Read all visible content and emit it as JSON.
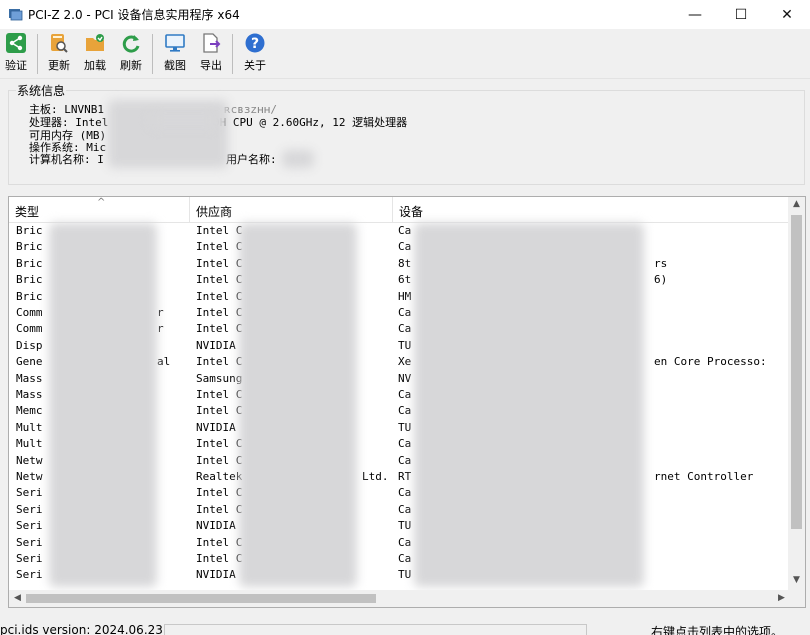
{
  "window": {
    "title": "PCI-Z 2.0 - PCI 设备信息实用程序 x64",
    "minimize": "—",
    "maximize": "☐",
    "close": "✕"
  },
  "toolbar": {
    "verify": "验证",
    "update": "更新",
    "load": "加载",
    "refresh": "刷新",
    "screenshot": "截图",
    "export": "导出",
    "about": "关于"
  },
  "system_info": {
    "group_title": "系统信息",
    "motherboard": "主板:  LNVNB1",
    "motherboard_tail": "ʀcʙɜᴢʜʜ/",
    "cpu": "处理器: Intel",
    "cpu_tail": "0H CPU @ 2.60GHz, 12 逻辑处理器",
    "memory": "可用内存 (MB)",
    "os": "操作系统: Mic",
    "computer_name": "计算机名称: I",
    "user_name": "用户名称:"
  },
  "list": {
    "headers": [
      "类型",
      "供应商",
      "设备"
    ],
    "sort_indicator": "^",
    "rows": [
      [
        "Bric",
        "Intel C",
        "Ca"
      ],
      [
        "Bric",
        "Intel C",
        "Ca"
      ],
      [
        "Bric",
        "Intel C",
        "8t",
        "rs"
      ],
      [
        "Bric",
        "Intel C",
        "6t",
        "6)"
      ],
      [
        "Bric",
        "Intel C",
        "HM"
      ],
      [
        "Comm",
        "Intel C",
        "Ca",
        "r"
      ],
      [
        "Comm",
        "Intel C",
        "Ca",
        "r"
      ],
      [
        "Disp",
        "NVIDIA",
        "TU"
      ],
      [
        "Gene",
        "Intel C",
        "Xe",
        "al",
        "en Core Processo:"
      ],
      [
        "Mass",
        "Samsung",
        "NV"
      ],
      [
        "Mass",
        "Intel C",
        "Ca"
      ],
      [
        "Memc",
        "Intel C",
        "Ca"
      ],
      [
        "Mult",
        "NVIDIA",
        "TU"
      ],
      [
        "Mult",
        "Intel C",
        "Ca"
      ],
      [
        "Netw",
        "Intel C",
        "Ca"
      ],
      [
        "Netw",
        "Realtek",
        "RT",
        "Ltd.",
        "rnet Controller"
      ],
      [
        "Seri",
        "Intel C",
        "Ca"
      ],
      [
        "Seri",
        "Intel C",
        "Ca"
      ],
      [
        "Seri",
        "NVIDIA",
        "TU"
      ],
      [
        "Seri",
        "Intel C",
        "Ca"
      ],
      [
        "Seri",
        "Intel C",
        "Ca"
      ],
      [
        "Seri",
        "NVIDIA",
        "TU"
      ]
    ]
  },
  "statusbar": {
    "left": "pci.ids version: 2024.06.23",
    "right": "右键点击列表中的选项。"
  }
}
